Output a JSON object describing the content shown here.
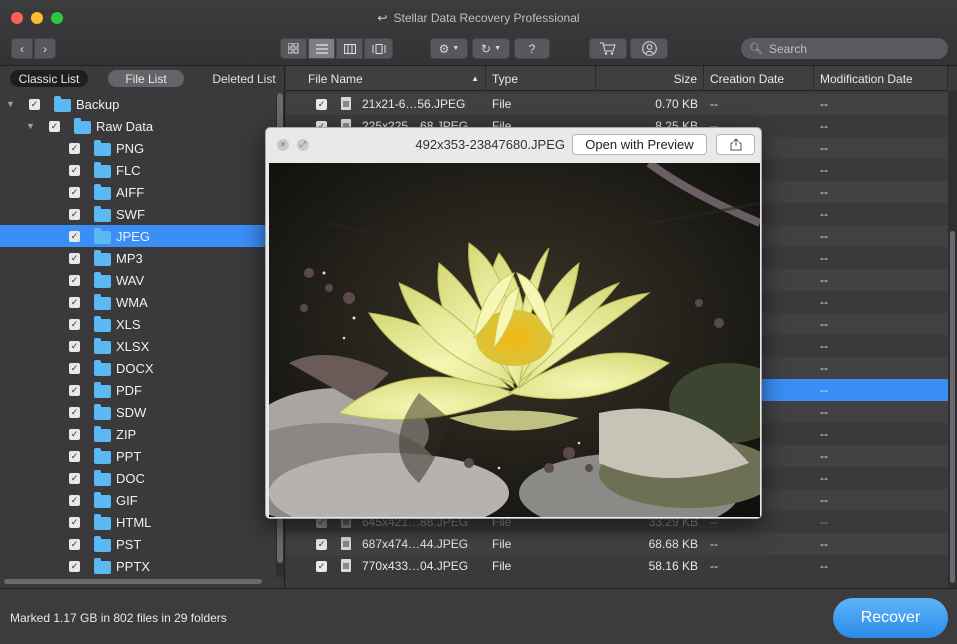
{
  "window": {
    "title": "Stellar Data Recovery Professional"
  },
  "toolbar": {
    "back": "‹",
    "forward": "›",
    "help": "?",
    "search_placeholder": "Search"
  },
  "left_panel": {
    "modes": [
      "Classic List",
      "File List",
      "Deleted List"
    ],
    "tree": [
      {
        "label": "Backup",
        "level": 0,
        "expanded": true,
        "selected": false
      },
      {
        "label": "Raw Data",
        "level": 1,
        "expanded": true,
        "selected": false
      },
      {
        "label": "PNG",
        "level": 2,
        "selected": false
      },
      {
        "label": "FLC",
        "level": 2,
        "selected": false
      },
      {
        "label": "AIFF",
        "level": 2,
        "selected": false
      },
      {
        "label": "SWF",
        "level": 2,
        "selected": false
      },
      {
        "label": "JPEG",
        "level": 2,
        "selected": true
      },
      {
        "label": "MP3",
        "level": 2,
        "selected": false
      },
      {
        "label": "WAV",
        "level": 2,
        "selected": false
      },
      {
        "label": "WMA",
        "level": 2,
        "selected": false
      },
      {
        "label": "XLS",
        "level": 2,
        "selected": false
      },
      {
        "label": "XLSX",
        "level": 2,
        "selected": false
      },
      {
        "label": "DOCX",
        "level": 2,
        "selected": false
      },
      {
        "label": "PDF",
        "level": 2,
        "selected": false
      },
      {
        "label": "SDW",
        "level": 2,
        "selected": false
      },
      {
        "label": "ZIP",
        "level": 2,
        "selected": false
      },
      {
        "label": "PPT",
        "level": 2,
        "selected": false
      },
      {
        "label": "DOC",
        "level": 2,
        "selected": false
      },
      {
        "label": "GIF",
        "level": 2,
        "selected": false
      },
      {
        "label": "HTML",
        "level": 2,
        "selected": false
      },
      {
        "label": "PST",
        "level": 2,
        "selected": false
      },
      {
        "label": "PPTX",
        "level": 2,
        "selected": false
      }
    ]
  },
  "file_table": {
    "columns": [
      "File Name",
      "Type",
      "Size",
      "Creation Date",
      "Modification Date"
    ],
    "rows": [
      {
        "name": "21x21-6…56.JPEG",
        "type": "File",
        "size": "0.70 KB",
        "created": "--",
        "modified": "--",
        "selected": false,
        "dim": false
      },
      {
        "name": "225x225…68.JPEG",
        "type": "File",
        "size": "8.25 KB",
        "created": "--",
        "modified": "--",
        "selected": false,
        "dim": false
      },
      {
        "name": "",
        "type": "",
        "size": "",
        "created": "",
        "modified": "--",
        "selected": false,
        "dim": false
      },
      {
        "name": "",
        "type": "",
        "size": "",
        "created": "",
        "modified": "--",
        "selected": false,
        "dim": false
      },
      {
        "name": "",
        "type": "",
        "size": "",
        "created": "",
        "modified": "--",
        "selected": false,
        "dim": false
      },
      {
        "name": "",
        "type": "",
        "size": "",
        "created": "",
        "modified": "--",
        "selected": false,
        "dim": false
      },
      {
        "name": "",
        "type": "",
        "size": "",
        "created": "",
        "modified": "--",
        "selected": false,
        "dim": false
      },
      {
        "name": "",
        "type": "",
        "size": "",
        "created": "",
        "modified": "--",
        "selected": false,
        "dim": false
      },
      {
        "name": "",
        "type": "",
        "size": "",
        "created": "",
        "modified": "--",
        "selected": false,
        "dim": false
      },
      {
        "name": "",
        "type": "",
        "size": "",
        "created": "",
        "modified": "--",
        "selected": false,
        "dim": false
      },
      {
        "name": "",
        "type": "",
        "size": "",
        "created": "",
        "modified": "--",
        "selected": false,
        "dim": false
      },
      {
        "name": "",
        "type": "",
        "size": "",
        "created": "",
        "modified": "--",
        "selected": false,
        "dim": false
      },
      {
        "name": "",
        "type": "",
        "size": "",
        "created": "",
        "modified": "--",
        "selected": false,
        "dim": false
      },
      {
        "name": "",
        "type": "",
        "size": "",
        "created": "",
        "modified": "--",
        "selected": true,
        "dim": false
      },
      {
        "name": "",
        "type": "",
        "size": "",
        "created": "",
        "modified": "--",
        "selected": false,
        "dim": false
      },
      {
        "name": "",
        "type": "",
        "size": "",
        "created": "",
        "modified": "--",
        "selected": false,
        "dim": false
      },
      {
        "name": "",
        "type": "",
        "size": "",
        "created": "",
        "modified": "--",
        "selected": false,
        "dim": false
      },
      {
        "name": "",
        "type": "",
        "size": "",
        "created": "",
        "modified": "--",
        "selected": false,
        "dim": false
      },
      {
        "name": "",
        "type": "",
        "size": "",
        "created": "",
        "modified": "--",
        "selected": false,
        "dim": false
      },
      {
        "name": "645x421…88.JPEG",
        "type": "File",
        "size": "33.29 KB",
        "created": "--",
        "modified": "--",
        "selected": false,
        "dim": true
      },
      {
        "name": "687x474…44.JPEG",
        "type": "File",
        "size": "68.68 KB",
        "created": "--",
        "modified": "--",
        "selected": false,
        "dim": false
      },
      {
        "name": "770x433…04.JPEG",
        "type": "File",
        "size": "58.16 KB",
        "created": "--",
        "modified": "--",
        "selected": false,
        "dim": false
      }
    ]
  },
  "preview": {
    "filename": "492x353-23847680.JPEG",
    "open_button": "Open with Preview"
  },
  "status": {
    "text": "Marked 1.17 GB in 802 files in 29 folders",
    "recover_button": "Recover"
  },
  "colors": {
    "accent": "#3a8ef6",
    "folder": "#5cb8f2",
    "recover": "#2a8be8"
  }
}
